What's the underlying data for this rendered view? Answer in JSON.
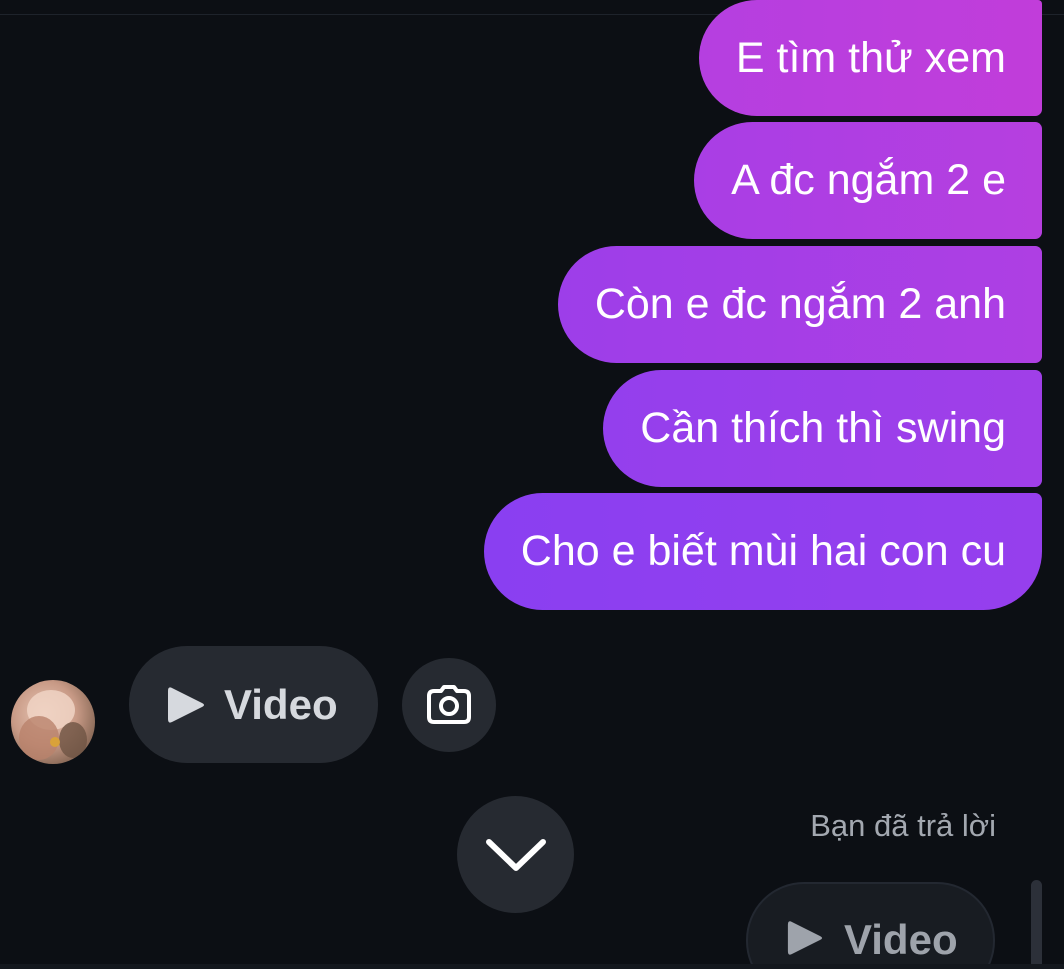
{
  "messages": [
    {
      "text": "E tìm thử xem",
      "from": "me"
    },
    {
      "text": "A đc ngắm 2 e",
      "from": "me"
    },
    {
      "text": "Còn e đc ngắm 2 anh",
      "from": "me"
    },
    {
      "text": "Cần thích thì swing",
      "from": "me"
    },
    {
      "text": "Cho e biết mùi hai con cu",
      "from": "me"
    }
  ],
  "incoming": {
    "video_label": "Video",
    "play_icon": "play-icon",
    "camera_icon": "camera-icon"
  },
  "scroll_down_icon": "chevron-down-icon",
  "reply": {
    "status": "Bạn đã trả lời",
    "video_label": "Video"
  },
  "colors": {
    "background": "#0c0f14",
    "bubble_top": "#c13dda",
    "bubble_bottom": "#8a3ff1",
    "pill": "#262a31",
    "muted_text": "#a3a8b0"
  }
}
